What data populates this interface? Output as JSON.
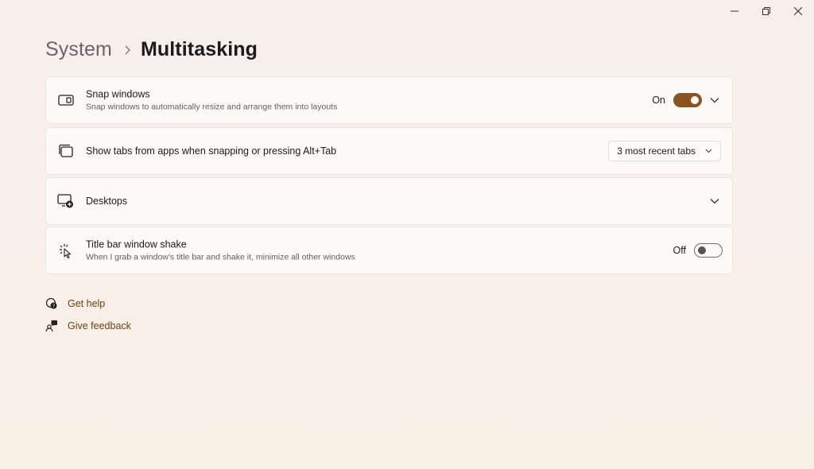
{
  "window": {
    "minimize_icon": "minimize-icon",
    "maximize_icon": "restore-icon",
    "close_icon": "close-icon"
  },
  "breadcrumb": {
    "parent": "System",
    "current": "Multitasking"
  },
  "settings": [
    {
      "icon": "snap-windows-icon",
      "title": "Snap windows",
      "description": "Snap windows to automatically resize and arrange them into layouts",
      "state_label": "On",
      "toggle": true,
      "expandable": true
    },
    {
      "icon": "tabs-icon",
      "title": "Show tabs from apps when snapping or pressing Alt+Tab",
      "dropdown_value": "3 most recent tabs"
    },
    {
      "icon": "desktops-icon",
      "title": "Desktops",
      "expandable": true
    },
    {
      "icon": "shake-icon",
      "title": "Title bar window shake",
      "description": "When I grab a window's title bar and shake it, minimize all other windows",
      "state_label": "Off",
      "toggle": false
    }
  ],
  "links": {
    "get_help": "Get help",
    "give_feedback": "Give feedback"
  },
  "colors": {
    "accent": "#8a5320",
    "link": "#6b3f14"
  }
}
